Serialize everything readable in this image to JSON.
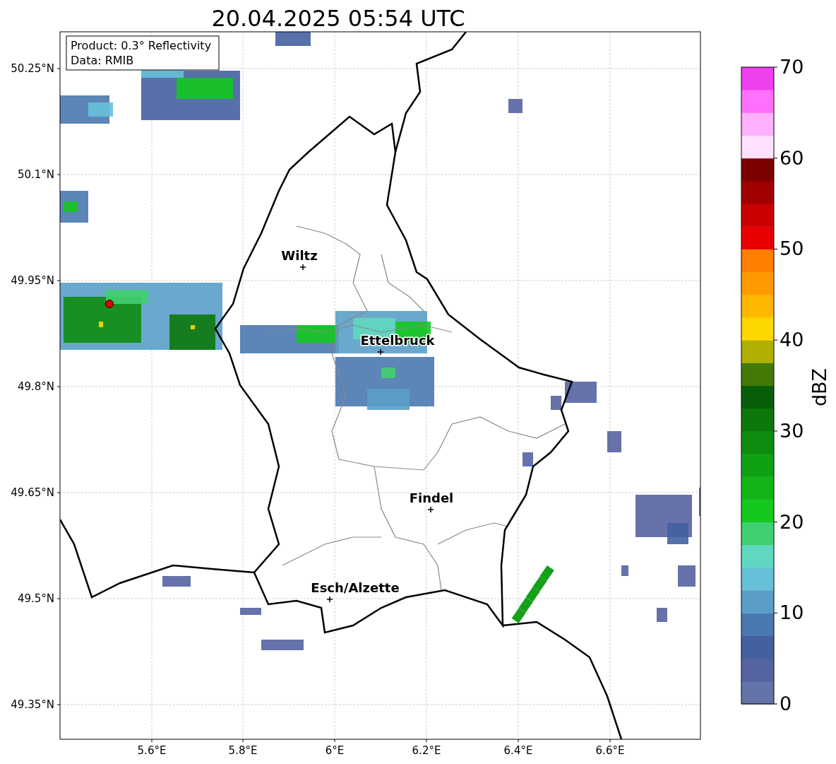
{
  "title": "20.04.2025 05:54 UTC",
  "info_box": [
    "Product: 0.3° Reflectivity",
    "Data: RMIB"
  ],
  "latitude_ticks": [
    "50.25°N",
    "50.1°N",
    "49.95°N",
    "49.8°N",
    "49.65°N",
    "49.5°N",
    "49.35°N"
  ],
  "longitude_ticks": [
    "5.6°E",
    "5.8°E",
    "6°E",
    "6.2°E",
    "6.4°E",
    "6.6°E"
  ],
  "cities": [
    {
      "name": "Wiltz"
    },
    {
      "name": "Ettelbruck"
    },
    {
      "name": "Findel"
    },
    {
      "name": "Esch/Alzette"
    }
  ],
  "colorbar": {
    "label": "dBZ",
    "ticks": [
      "70",
      "60",
      "50",
      "40",
      "30",
      "20",
      "10",
      "0"
    ],
    "bands": [
      {
        "color": "#6474a8"
      },
      {
        "color": "#5563a0"
      },
      {
        "color": "#4460a0"
      },
      {
        "color": "#4a78b0"
      },
      {
        "color": "#5a9ec8"
      },
      {
        "color": "#66c0d8"
      },
      {
        "color": "#60d8c0"
      },
      {
        "color": "#40d070"
      },
      {
        "color": "#14c81e"
      },
      {
        "color": "#12b418"
      },
      {
        "color": "#10a014"
      },
      {
        "color": "#0e8c10"
      },
      {
        "color": "#0c780c"
      },
      {
        "color": "#085e08"
      },
      {
        "color": "#447a08"
      },
      {
        "color": "#b0b000"
      },
      {
        "color": "#ffd700"
      },
      {
        "color": "#ffb800"
      },
      {
        "color": "#ff9a00"
      },
      {
        "color": "#ff7f00"
      },
      {
        "color": "#e80000"
      },
      {
        "color": "#c80000"
      },
      {
        "color": "#a00000"
      },
      {
        "color": "#7a0000"
      },
      {
        "color": "#ffe0ff"
      },
      {
        "color": "#ffb0ff"
      },
      {
        "color": "#ff70ff"
      },
      {
        "color": "#ee40ee"
      }
    ]
  }
}
